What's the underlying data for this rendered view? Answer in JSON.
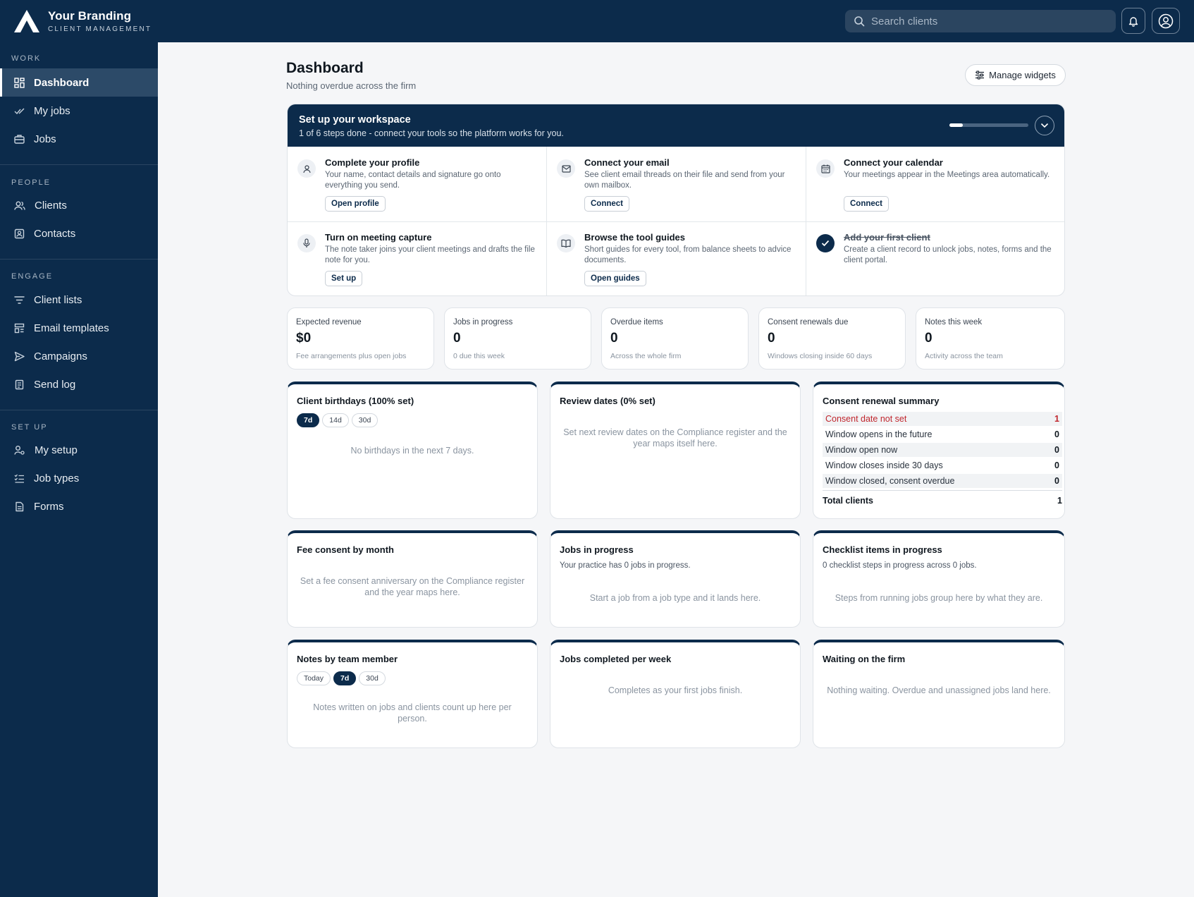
{
  "brand": {
    "name": "Your Branding",
    "subtitle": "CLIENT MANAGEMENT"
  },
  "topbar": {
    "search_placeholder": "Search clients"
  },
  "sidebar": {
    "sections": [
      {
        "label": "WORK",
        "items": [
          {
            "label": "Dashboard",
            "icon": "dashboard-icon",
            "active": true
          },
          {
            "label": "My jobs",
            "icon": "check-list-icon"
          },
          {
            "label": "Jobs",
            "icon": "briefcase-icon"
          }
        ]
      },
      {
        "label": "PEOPLE",
        "items": [
          {
            "label": "Clients",
            "icon": "users-icon"
          },
          {
            "label": "Contacts",
            "icon": "contact-card-icon"
          }
        ]
      },
      {
        "label": "ENGAGE",
        "items": [
          {
            "label": "Client lists",
            "icon": "filter-icon"
          },
          {
            "label": "Email templates",
            "icon": "template-icon"
          },
          {
            "label": "Campaigns",
            "icon": "send-icon"
          },
          {
            "label": "Send log",
            "icon": "log-icon"
          }
        ]
      },
      {
        "label": "SET UP",
        "items": [
          {
            "label": "My setup",
            "icon": "user-settings-icon"
          },
          {
            "label": "Job types",
            "icon": "list-check-icon"
          },
          {
            "label": "Forms",
            "icon": "form-icon"
          }
        ]
      }
    ]
  },
  "page": {
    "title": "Dashboard",
    "subtitle": "Nothing overdue across the firm",
    "manage_label": "Manage widgets"
  },
  "setup": {
    "title": "Set up your workspace",
    "subtitle": "1 of 6 steps done - connect your tools so the platform works for you.",
    "progress": 0.1667,
    "steps": [
      {
        "title": "Complete your profile",
        "desc": "Your name, contact details and signature go onto everything you send.",
        "button": "Open profile",
        "icon": "user-icon",
        "done": false
      },
      {
        "title": "Connect your email",
        "desc": "See client email threads on their file and send from your own mailbox.",
        "button": "Connect",
        "icon": "mail-icon",
        "done": false
      },
      {
        "title": "Connect your calendar",
        "desc": "Your meetings appear in the Meetings area automatically.",
        "button": "Connect",
        "icon": "calendar-icon",
        "done": false
      },
      {
        "title": "Turn on meeting capture",
        "desc": "The note taker joins your client meetings and drafts the file note for you.",
        "button": "Set up",
        "icon": "microphone-icon",
        "done": false
      },
      {
        "title": "Browse the tool guides",
        "desc": "Short guides for every tool, from balance sheets to advice documents.",
        "button": "Open guides",
        "icon": "book-icon",
        "done": false
      },
      {
        "title": "Add your first client",
        "desc": "Create a client record to unlock jobs, notes, forms and the client portal.",
        "button": "",
        "icon": "check-icon",
        "done": true
      }
    ]
  },
  "kpis": [
    {
      "label": "Expected revenue",
      "value": "$0",
      "note": "Fee arrangements plus open jobs"
    },
    {
      "label": "Jobs in progress",
      "value": "0",
      "note": "0 due this week"
    },
    {
      "label": "Overdue items",
      "value": "0",
      "note": "Across the whole firm"
    },
    {
      "label": "Consent renewals due",
      "value": "0",
      "note": "Windows closing inside 60 days"
    },
    {
      "label": "Notes this week",
      "value": "0",
      "note": "Activity across the team"
    }
  ],
  "widgets": {
    "birthdays": {
      "title": "Client birthdays (100% set)",
      "pills": [
        "7d",
        "14d",
        "30d"
      ],
      "active": 0,
      "empty": "No birthdays in the next 7 days."
    },
    "review": {
      "title": "Review dates (0% set)",
      "empty": "Set next review dates on the Compliance register and the year maps itself here."
    },
    "consent": {
      "title": "Consent renewal summary",
      "rows": [
        {
          "label": "Consent date not set",
          "value": "1",
          "warn": true
        },
        {
          "label": "Window opens in the future",
          "value": "0"
        },
        {
          "label": "Window open now",
          "value": "0"
        },
        {
          "label": "Window closes inside 30 days",
          "value": "0"
        },
        {
          "label": "Window closed, consent overdue",
          "value": "0"
        }
      ],
      "total_label": "Total clients",
      "total_value": "1"
    },
    "fee": {
      "title": "Fee consent by month",
      "empty": "Set a fee consent anniversary on the Compliance register and the year maps here."
    },
    "jobs_progress": {
      "title": "Jobs in progress",
      "sub": "Your practice has 0 jobs in progress.",
      "empty": "Start a job from a job type and it lands here."
    },
    "checklist": {
      "title": "Checklist items in progress",
      "sub": "0 checklist steps in progress across 0 jobs.",
      "empty": "Steps from running jobs group here by what they are."
    },
    "notes": {
      "title": "Notes by team member",
      "pills": [
        "Today",
        "7d",
        "30d"
      ],
      "active": 1,
      "empty": "Notes written on jobs and clients count up here per person."
    },
    "completed": {
      "title": "Jobs completed per week",
      "empty": "Completes as your first jobs finish."
    },
    "waiting": {
      "title": "Waiting on the firm",
      "empty": "Nothing waiting. Overdue and unassigned jobs land here."
    }
  },
  "colors": {
    "navy": "#0c2b4b",
    "warn": "#c0262d",
    "background": "#f5f6f8"
  }
}
